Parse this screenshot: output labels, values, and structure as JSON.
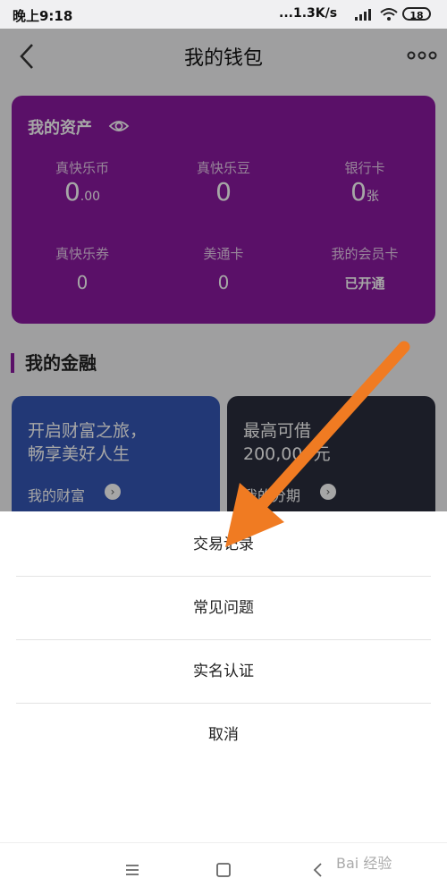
{
  "status_bar": {
    "time": "晚上9:18",
    "network_speed": "...1.3K/s",
    "battery": "18"
  },
  "header": {
    "title": "我的钱包"
  },
  "assets": {
    "title": "我的资产",
    "items": [
      {
        "label": "真快乐币",
        "value": "0",
        "suffix": ".00"
      },
      {
        "label": "真快乐豆",
        "value": "0",
        "suffix": ""
      },
      {
        "label": "银行卡",
        "value": "0",
        "suffix": "张"
      },
      {
        "label": "真快乐券",
        "value": "0",
        "suffix": ""
      },
      {
        "label": "美通卡",
        "value": "0",
        "suffix": ""
      },
      {
        "label": "我的会员卡",
        "value": "已开通",
        "suffix": ""
      }
    ]
  },
  "finance": {
    "title": "我的金融",
    "cards": [
      {
        "line1": "开启财富之旅，",
        "line2": "畅享美好人生",
        "link": "我的财富"
      },
      {
        "line1": "最高可借",
        "line2": "200,000元",
        "link": "我的分期"
      }
    ]
  },
  "action_sheet": {
    "items": [
      "交易记录",
      "常见问题",
      "实名认证"
    ],
    "cancel": "取消"
  },
  "watermark": "Bai 经验",
  "colors": {
    "card_purple": "#8a1aa0",
    "arrow_orange": "#f07b22"
  }
}
